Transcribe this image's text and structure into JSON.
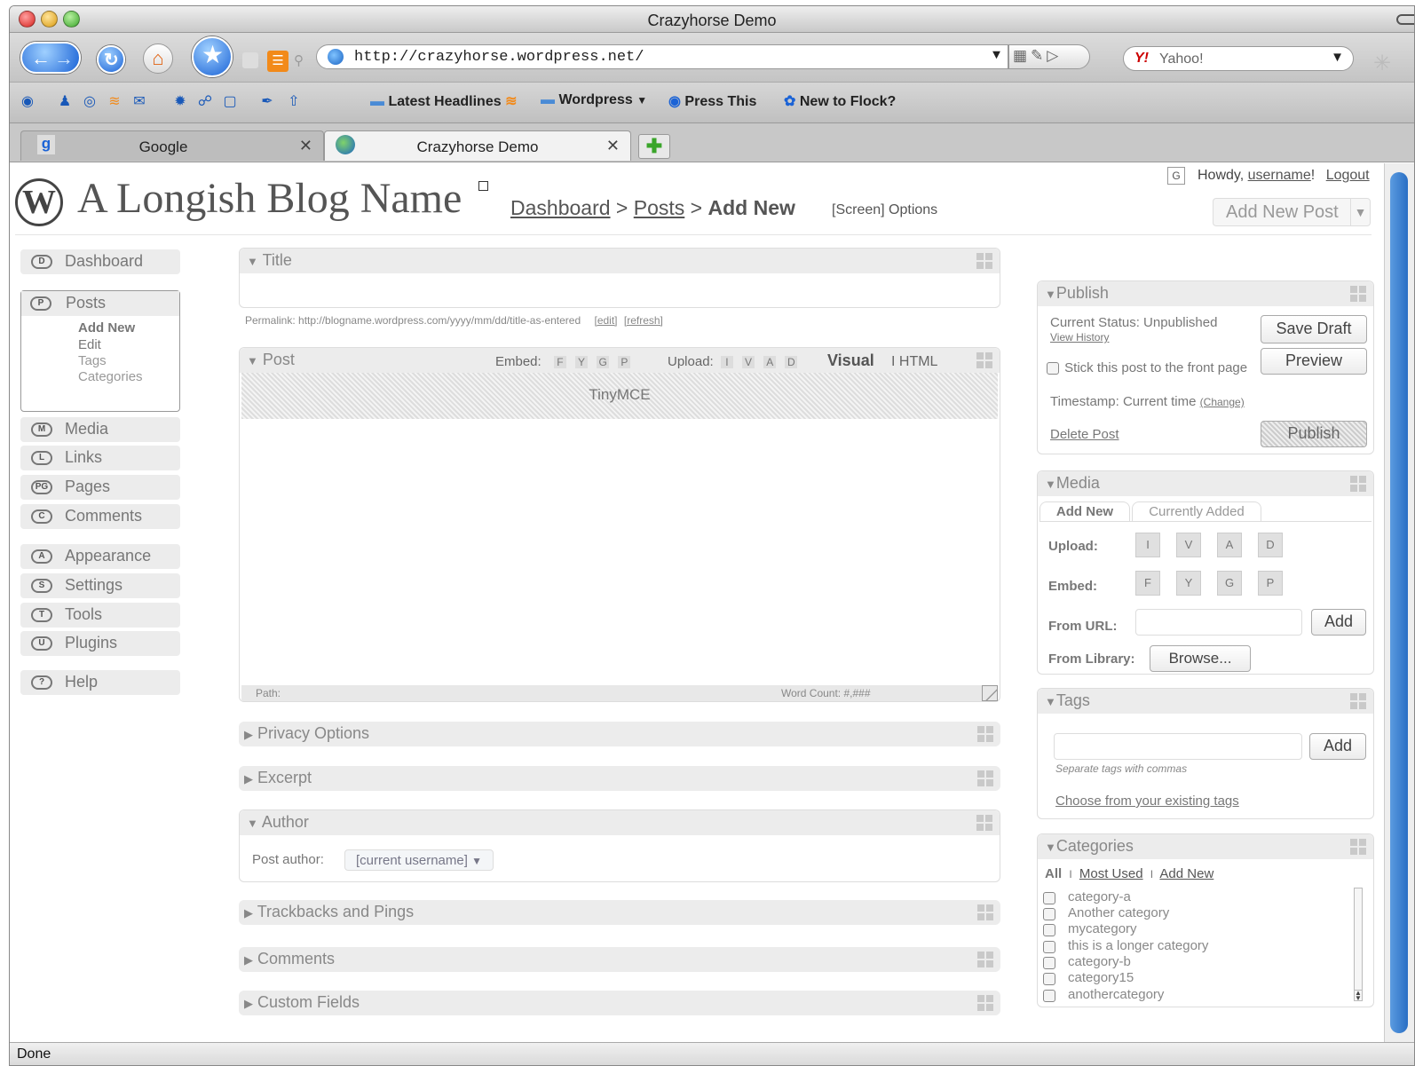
{
  "window": {
    "title": "Crazyhorse Demo"
  },
  "browser": {
    "url": "http://crazyhorse.wordpress.net/",
    "search_engine": "Yahoo!",
    "bookmarks": [
      "Latest Headlines",
      "Wordpress",
      "Press This",
      "New to Flock?"
    ],
    "tabs": [
      {
        "label": "Google",
        "active": false
      },
      {
        "label": "Crazyhorse Demo",
        "active": true
      }
    ],
    "status": "Done"
  },
  "header": {
    "blog_name": "A Longish Blog Name",
    "breadcrumb": {
      "dashboard": "Dashboard",
      "sep1": ">",
      "posts": "Posts",
      "sep2": ">",
      "current": "Add New"
    },
    "screen_options": "[Screen] Options",
    "g_badge": "G",
    "howdy": "Howdy,",
    "username": "username",
    "exclaim": "!",
    "logout": "Logout",
    "add_new_post": "Add New Post"
  },
  "sidebar": {
    "dashboard": {
      "icon": "D",
      "label": "Dashboard"
    },
    "posts": {
      "icon": "P",
      "label": "Posts",
      "sub": [
        "Add New",
        "Edit",
        "Tags",
        "Categories"
      ]
    },
    "media": {
      "icon": "M",
      "label": "Media"
    },
    "links": {
      "icon": "L",
      "label": "Links"
    },
    "pages": {
      "icon": "PG",
      "label": "Pages"
    },
    "comments": {
      "icon": "C",
      "label": "Comments"
    },
    "appearance": {
      "icon": "A",
      "label": "Appearance"
    },
    "settings": {
      "icon": "S",
      "label": "Settings"
    },
    "tools": {
      "icon": "T",
      "label": "Tools"
    },
    "plugins": {
      "icon": "U",
      "label": "Plugins"
    },
    "help": {
      "icon": "?",
      "label": "Help"
    }
  },
  "main": {
    "title_box": {
      "heading": "Title",
      "value": ""
    },
    "permalink": {
      "text": "Permalink: http://blogname.wordpress.com/yyyy/mm/dd/title-as-entered",
      "edit": "[edit]",
      "refresh": "[refresh]"
    },
    "post_box": {
      "heading": "Post",
      "embed_label": "Embed:",
      "embed_buttons": [
        "F",
        "Y",
        "G",
        "P"
      ],
      "upload_label": "Upload:",
      "upload_buttons": [
        "I",
        "V",
        "A",
        "D"
      ],
      "visual": "Visual",
      "html": "I HTML",
      "editor_toolbar": "TinyMCE",
      "path": "Path:",
      "word_count": "Word Count: #,###"
    },
    "privacy": "Privacy Options",
    "excerpt": "Excerpt",
    "author": {
      "heading": "Author",
      "label": "Post author:",
      "value": "[current username]"
    },
    "trackbacks": "Trackbacks and Pings",
    "comments": "Comments",
    "custom_fields": "Custom Fields"
  },
  "publish": {
    "heading": "Publish",
    "status": "Current Status: Unpublished",
    "view_history": "View History",
    "save_draft": "Save Draft",
    "preview": "Preview",
    "sticky": "Stick this post to the front page",
    "timestamp": "Timestamp: Current time",
    "change": "(Change)",
    "delete": "Delete Post",
    "publish": "Publish"
  },
  "media": {
    "heading": "Media",
    "tab_add_new": "Add New",
    "tab_current": "Currently Added",
    "upload_label": "Upload:",
    "upload_buttons": [
      "I",
      "V",
      "A",
      "D"
    ],
    "embed_label": "Embed:",
    "embed_buttons": [
      "F",
      "Y",
      "G",
      "P"
    ],
    "from_url": "From URL:",
    "add": "Add",
    "from_library": "From Library:",
    "browse": "Browse..."
  },
  "tags": {
    "heading": "Tags",
    "add": "Add",
    "hint": "Separate tags with commas",
    "choose": "Choose from your existing tags"
  },
  "categories": {
    "heading": "Categories",
    "all": "All",
    "sep1": "I",
    "most_used": "Most Used",
    "sep2": "I",
    "add_new": "Add New",
    "items": [
      "category-a",
      "Another category",
      "mycategory",
      "this is a longer category",
      "category-b",
      "category15",
      "anothercategory"
    ]
  },
  "colors": {
    "panel_header": "#ececec",
    "text": "#555555",
    "link_blue": "#1b63d6"
  }
}
